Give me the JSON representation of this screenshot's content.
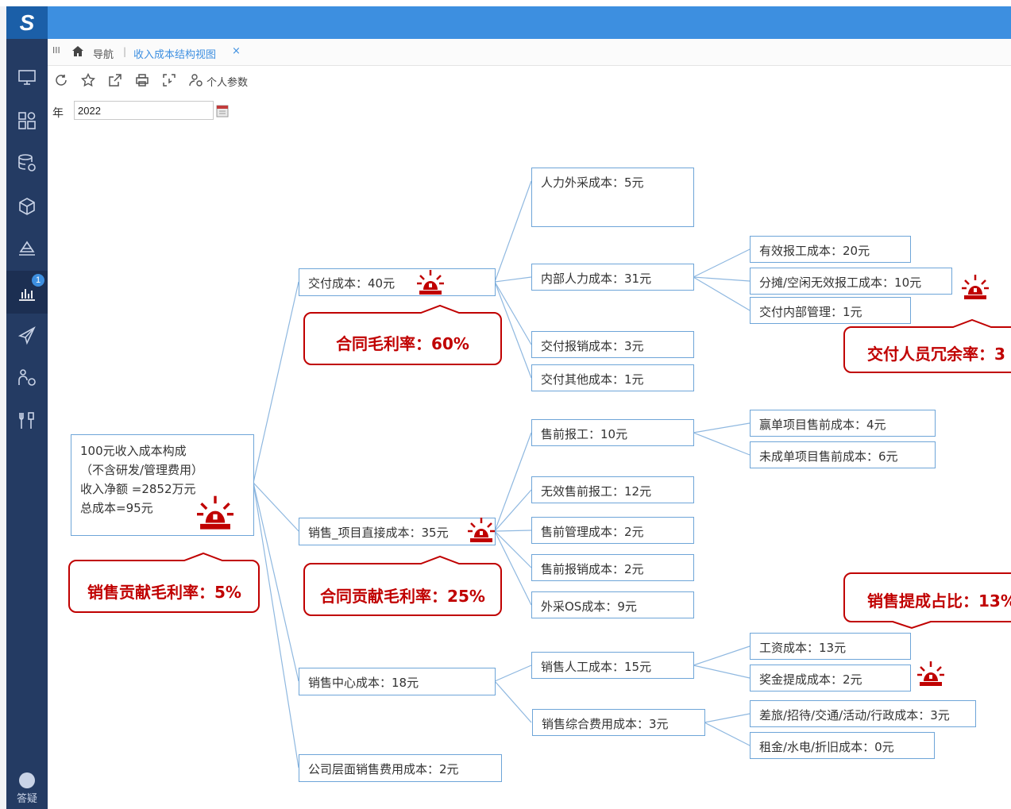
{
  "app": {
    "logo_text": "S",
    "colors": {
      "topbar": "#3d8fe0",
      "sidebar": "#243b63",
      "node_border": "#6ea5d8",
      "alert": "#c00000"
    }
  },
  "sidebar": {
    "items": [
      {
        "icon": "monitor-icon"
      },
      {
        "icon": "dashboard-icon"
      },
      {
        "icon": "database-settings-icon"
      },
      {
        "icon": "cube-icon"
      },
      {
        "icon": "stack-icon"
      },
      {
        "icon": "bar-chart-icon",
        "badge": "1",
        "active": true
      },
      {
        "icon": "send-icon"
      },
      {
        "icon": "network-settings-icon"
      },
      {
        "icon": "tools-icon"
      }
    ],
    "help_label": "答疑"
  },
  "tabbar": {
    "menu_icon": "III",
    "nav_label": "导航",
    "separator": "|",
    "active_tab": "收入成本结构视图",
    "close": "×"
  },
  "toolbar": {
    "icons": [
      "refresh-icon",
      "star-icon",
      "export-icon",
      "print-icon",
      "fullscreen-icon"
    ],
    "personal_params_label": "个人参数"
  },
  "params": {
    "year_label": "年",
    "year_value": "2022"
  },
  "tree": {
    "root": {
      "line1": "100元收入成本构成",
      "line2": "（不含研发/管理费用）",
      "line3": "收入净额 =2852万元",
      "line4": "总成本=95元"
    },
    "level1": {
      "delivery": "交付成本：40元",
      "sales_direct": "销售_项目直接成本：35元",
      "sales_center": "销售中心成本：18元",
      "company_sales": "公司层面销售费用成本：2元"
    },
    "level2": {
      "hr_outsource": "人力外采成本：5元",
      "internal_hr": "内部人力成本：31元",
      "delivery_reimburse": "交付报销成本：3元",
      "delivery_other": "交付其他成本：1元",
      "presales_work": "售前报工：10元",
      "invalid_presales": "无效售前报工：12元",
      "presales_mgmt": "售前管理成本：2元",
      "presales_reimburse": "售前报销成本：2元",
      "outsource_os": "外采OS成本：9元",
      "sales_labor": "销售人工成本：15元",
      "sales_general": "销售综合费用成本：3元"
    },
    "level3": {
      "valid_work": "有效报工成本：20元",
      "idle_invalid": "分摊/空闲无效报工成本：10元",
      "delivery_internal_mgmt": "交付内部管理：1元",
      "won_presales": "赢单项目售前成本：4元",
      "lost_presales": "未成单项目售前成本：6元",
      "salary": "工资成本：13元",
      "bonus": "奖金提成成本：2元",
      "travel": "差旅/招待/交通/活动/行政成本：3元",
      "rent": "租金/水电/折旧成本：0元"
    },
    "callouts": {
      "contract_gross_margin": "合同毛利率：60%",
      "sales_contribution_margin": "销售贡献毛利率：5%",
      "contract_contribution_margin": "合同贡献毛利率：25%",
      "delivery_redundancy": "交付人员冗余率：3",
      "sales_commission_ratio": "销售提成占比：13%"
    }
  }
}
